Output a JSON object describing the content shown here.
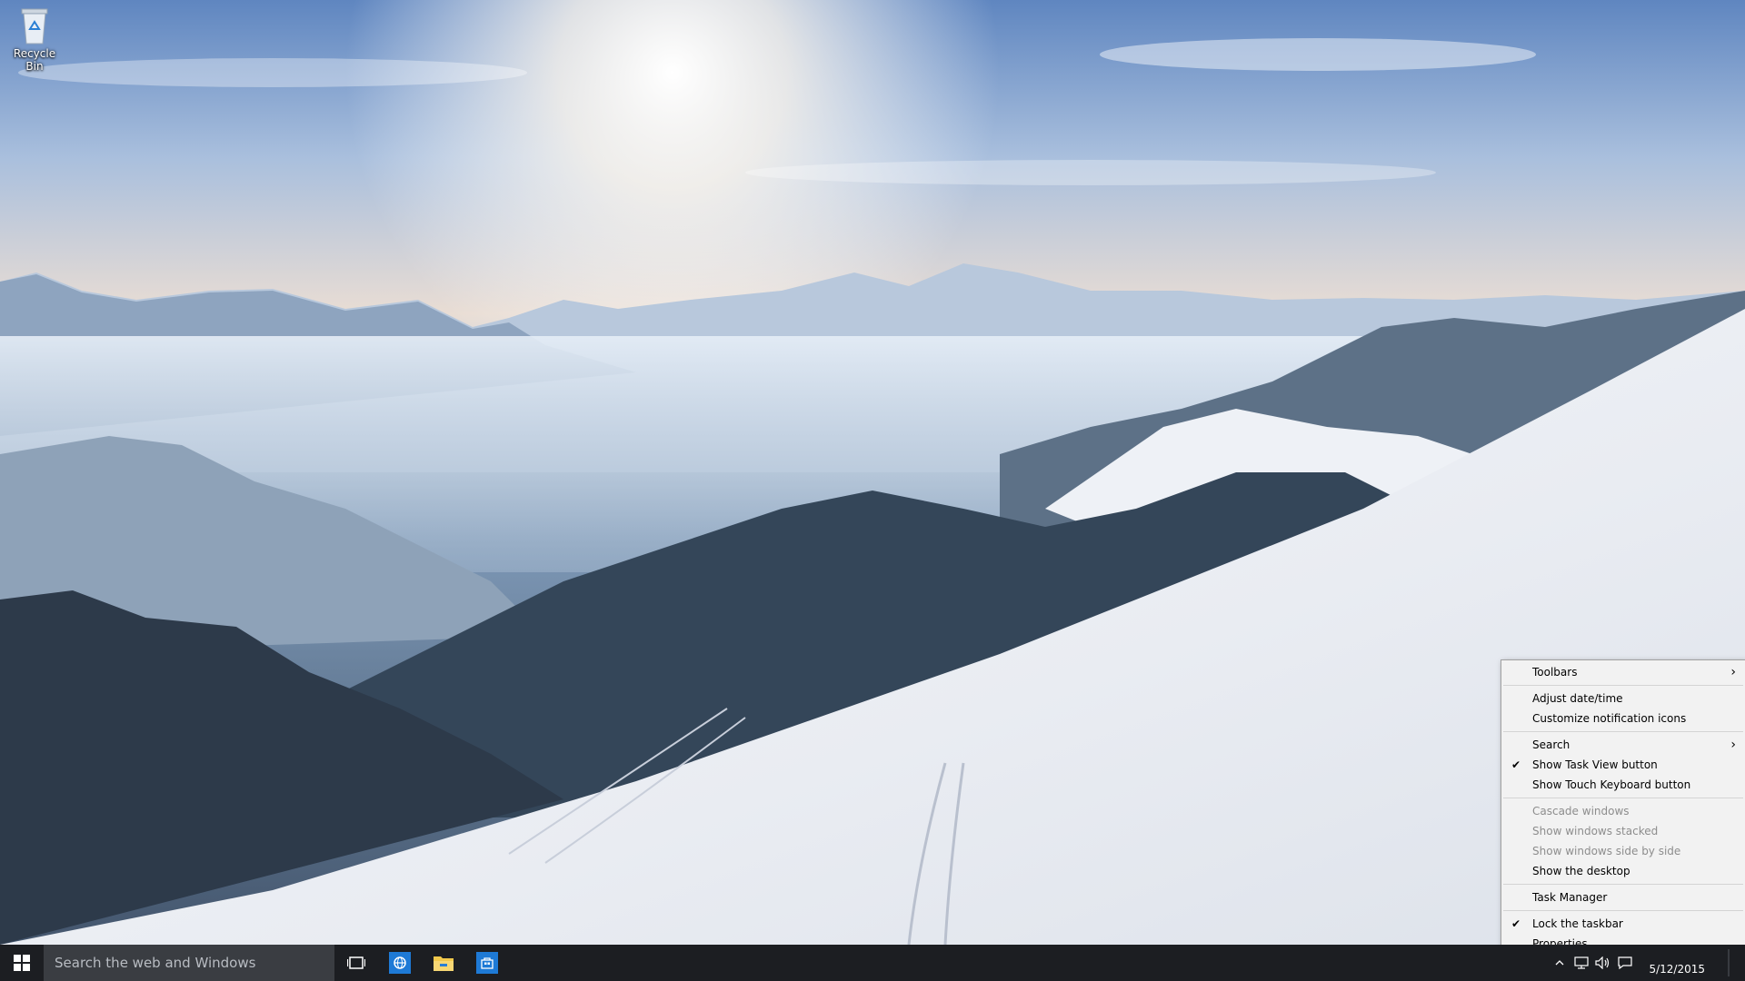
{
  "desktop": {
    "icons": [
      {
        "label": "Recycle Bin"
      }
    ]
  },
  "taskbar": {
    "search_placeholder": "Search the web and Windows",
    "apps": [
      {
        "icon": "ie-icon",
        "color": "#1e7ad6"
      },
      {
        "icon": "file-explorer-icon",
        "color": "#f2c94c"
      },
      {
        "icon": "store-icon",
        "color": "#1e7ad6"
      }
    ],
    "tray": {
      "clock_date": "5/12/2015"
    }
  },
  "context_menu": {
    "items": [
      {
        "label": "Toolbars",
        "submenu": true
      },
      {
        "separator": true
      },
      {
        "label": "Adjust date/time"
      },
      {
        "label": "Customize notification icons"
      },
      {
        "separator": true
      },
      {
        "label": "Search",
        "submenu": true
      },
      {
        "label": "Show Task View button",
        "checked": true
      },
      {
        "label": "Show Touch Keyboard button"
      },
      {
        "separator": true
      },
      {
        "label": "Cascade windows",
        "disabled": true
      },
      {
        "label": "Show windows stacked",
        "disabled": true
      },
      {
        "label": "Show windows side by side",
        "disabled": true
      },
      {
        "label": "Show the desktop"
      },
      {
        "separator": true
      },
      {
        "label": "Task Manager"
      },
      {
        "separator": true
      },
      {
        "label": "Lock the taskbar",
        "checked": true
      },
      {
        "label": "Properties"
      }
    ]
  },
  "colors": {
    "taskbar_bg": "#1c1e22",
    "search_bg": "#3a3d42",
    "menu_bg": "#f2f2f2",
    "disabled_text": "#8d8d8d"
  }
}
